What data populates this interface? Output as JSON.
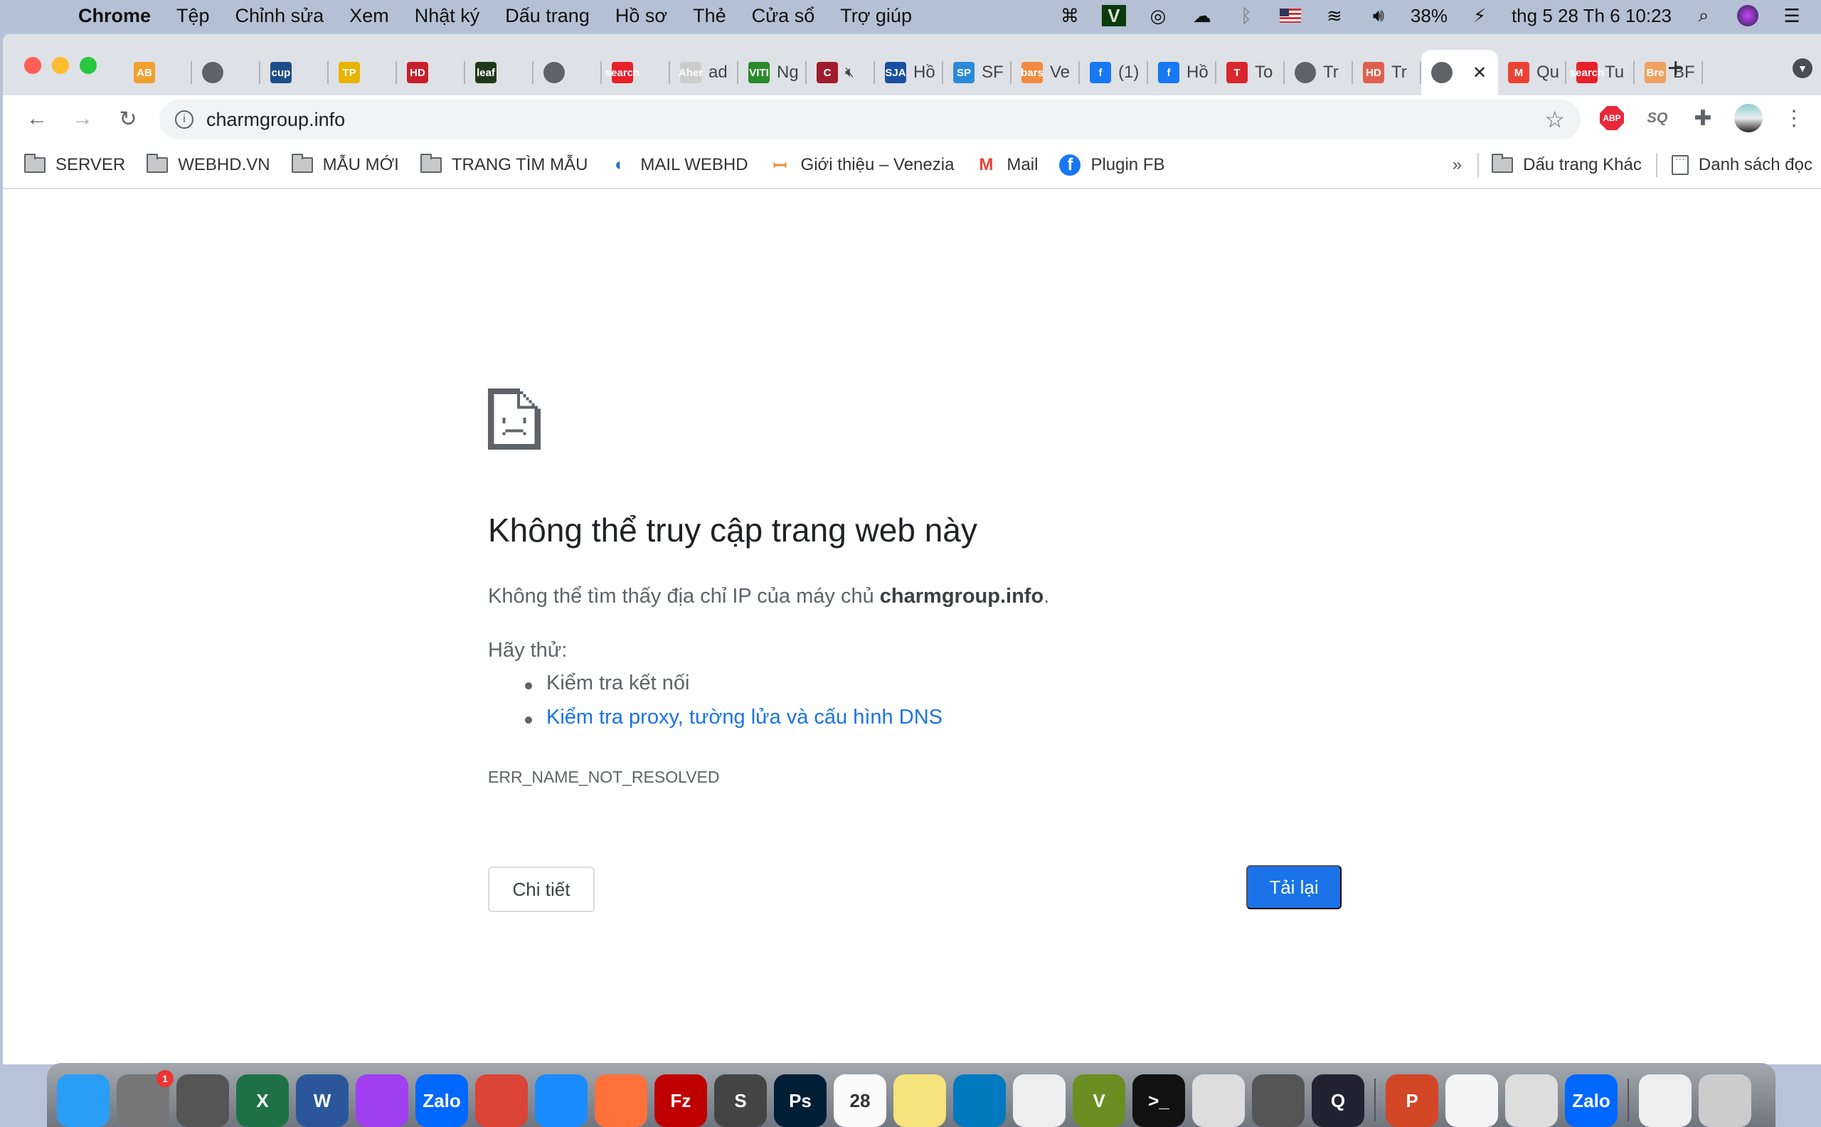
{
  "menubar": {
    "app": "Chrome",
    "items": [
      "Tệp",
      "Chỉnh sửa",
      "Xem",
      "Nhật ký",
      "Dấu trang",
      "Hồ sơ",
      "Thẻ",
      "Cửa sổ",
      "Trợ giúp"
    ],
    "battery": "38%",
    "datetime": "thg 5 28 Th 6  10:23"
  },
  "tabs": [
    {
      "label": "",
      "fav": "AB",
      "color": "#f0a030"
    },
    {
      "label": "",
      "fav": "globe",
      "color": "#5f6368"
    },
    {
      "label": "",
      "fav": "cup",
      "color": "#1d4e89"
    },
    {
      "label": "",
      "fav": "TP",
      "color": "#e8b400"
    },
    {
      "label": "",
      "fav": "HD",
      "color": "#c8202a"
    },
    {
      "label": "",
      "fav": "leaf",
      "color": "#1f3a1a"
    },
    {
      "label": "",
      "fav": "globe",
      "color": "#5f6368"
    },
    {
      "label": "",
      "fav": "search",
      "color": "#e8202a"
    },
    {
      "label": "ad",
      "fav": "Aher",
      "color": "#ccc"
    },
    {
      "label": "Ng",
      "fav": "VITI",
      "color": "#2a8a2a"
    },
    {
      "label": "",
      "fav": "C",
      "color": "#a01c2c",
      "muted": true
    },
    {
      "label": "Hồ",
      "fav": "SJA",
      "color": "#1a4fa0"
    },
    {
      "label": "SF",
      "fav": "SP",
      "color": "#2a8ad8"
    },
    {
      "label": "Ve",
      "fav": "bars",
      "color": "#f08a40"
    },
    {
      "label": "(1)",
      "fav": "f",
      "color": "#1877f2"
    },
    {
      "label": "Hồ",
      "fav": "f",
      "color": "#1877f2"
    },
    {
      "label": "To",
      "fav": "T",
      "color": "#d8262a"
    },
    {
      "label": "Tr",
      "fav": "globe",
      "color": "#5f6368"
    },
    {
      "label": "Tr",
      "fav": "HD",
      "color": "#e06050"
    },
    {
      "label": "",
      "fav": "globe",
      "color": "#5f6368",
      "active": true,
      "close": "✕"
    },
    {
      "label": "Qu",
      "fav": "M",
      "color": "#ea4335"
    },
    {
      "label": "Tu",
      "fav": "search",
      "color": "#e8202a"
    },
    {
      "label": "BF",
      "fav": "Bre",
      "color": "#f0a060"
    }
  ],
  "toolbar": {
    "url": "charmgroup.info",
    "extensions": [
      "ABP",
      "SQ"
    ]
  },
  "bookmarks": {
    "items": [
      {
        "label": "SERVER",
        "icon": "folder"
      },
      {
        "label": "WEBHD.VN",
        "icon": "folder"
      },
      {
        "label": "MẪU MỚI",
        "icon": "folder"
      },
      {
        "label": "TRANG TÌM MẪU",
        "icon": "folder"
      },
      {
        "label": "MAIL WEBHD",
        "icon": "mail-webhd"
      },
      {
        "label": "Giới thiệu – Venezia",
        "icon": "venezia"
      },
      {
        "label": "Mail",
        "icon": "gmail"
      },
      {
        "label": "Plugin FB",
        "icon": "facebook"
      }
    ],
    "overflow": "»",
    "other": "Dấu trang Khác",
    "reading_list": "Danh sách đọc"
  },
  "error": {
    "title": "Không thể truy cập trang web này",
    "message_prefix": "Không thể tìm thấy địa chỉ IP của máy chủ ",
    "host": "charmgroup.info",
    "message_suffix": ".",
    "try_label": "Hãy thử:",
    "suggestions": [
      "Kiểm tra kết nối",
      "Kiểm tra proxy, tường lửa và cấu hình DNS"
    ],
    "code": "ERR_NAME_NOT_RESOLVED",
    "details_button": "Chi tiết",
    "reload_button": "Tải lại",
    "link_color": "#1a73e8"
  },
  "dock": {
    "apps": [
      {
        "name": "finder",
        "label": "",
        "color": "#2a9df4"
      },
      {
        "name": "system-preferences",
        "label": "",
        "color": "#777",
        "badge": "1"
      },
      {
        "name": "launchpad",
        "label": "",
        "color": "#555"
      },
      {
        "name": "excel",
        "label": "X",
        "color": "#1e7145"
      },
      {
        "name": "word",
        "label": "W",
        "color": "#2b579a"
      },
      {
        "name": "messenger",
        "label": "",
        "color": "#a040f0"
      },
      {
        "name": "zalo",
        "label": "Zalo",
        "color": "#0068ff"
      },
      {
        "name": "chrome",
        "label": "",
        "color": "#db4437"
      },
      {
        "name": "safari",
        "label": "",
        "color": "#1a8cff"
      },
      {
        "name": "firefox",
        "label": "",
        "color": "#ff7139"
      },
      {
        "name": "filezilla",
        "label": "Fz",
        "color": "#bf0000"
      },
      {
        "name": "sublime-text",
        "label": "S",
        "color": "#444"
      },
      {
        "name": "photoshop",
        "label": "Ps",
        "color": "#001e36"
      },
      {
        "name": "calendar",
        "label": "28",
        "color": "#fafafa"
      },
      {
        "name": "notes",
        "label": "",
        "color": "#f5e27a"
      },
      {
        "name": "trello",
        "label": "",
        "color": "#0079bf"
      },
      {
        "name": "reminders",
        "label": "",
        "color": "#eee"
      },
      {
        "name": "vim",
        "label": "V",
        "color": "#6b8e23"
      },
      {
        "name": "terminal",
        "label": ">_",
        "color": "#111"
      },
      {
        "name": "migration",
        "label": "",
        "color": "#ddd"
      },
      {
        "name": "calculator",
        "label": "",
        "color": "#555"
      },
      {
        "name": "quicktime",
        "label": "Q",
        "color": "#223"
      },
      {
        "name": "powerpoint",
        "label": "P",
        "color": "#d24726"
      },
      {
        "name": "textedit",
        "label": "",
        "color": "#f4f4f4"
      },
      {
        "name": "printer",
        "label": "",
        "color": "#ddd"
      },
      {
        "name": "zalo-2",
        "label": "Zalo",
        "color": "#0068ff"
      },
      {
        "name": "lock",
        "label": "",
        "color": "#eee"
      },
      {
        "name": "trash",
        "label": "",
        "color": "#ccc"
      }
    ]
  }
}
